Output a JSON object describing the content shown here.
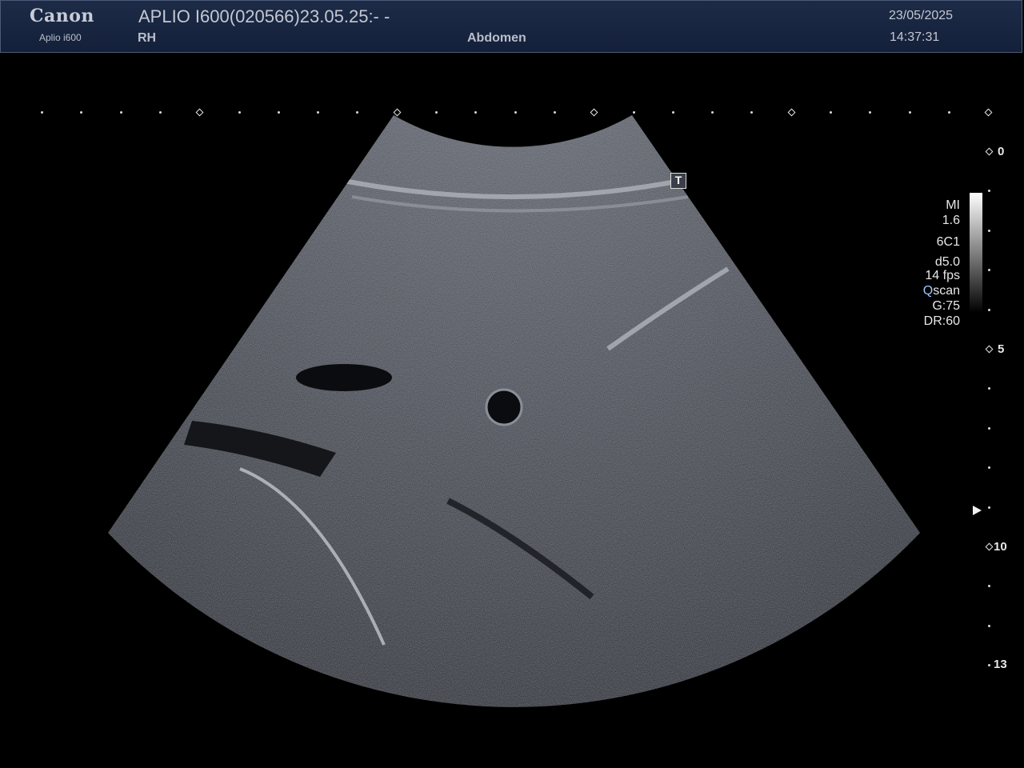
{
  "header": {
    "brand": "Canon",
    "model": "Aplio i600",
    "study": "APLIO I600(020566)23.05.25:- -",
    "side": "RH",
    "preset": "Abdomen",
    "date": "23/05/2025",
    "time": "14:37:31"
  },
  "focus_marker": "T",
  "params": {
    "mi_label": "MI",
    "mi_value": "1.6",
    "probe": "6C1",
    "depth": "d5.0",
    "fps": "14 fps",
    "mode_q": "Q",
    "mode_rest": "scan",
    "gain": "G:75",
    "dynamic_range": "DR:60"
  },
  "depth_scale": {
    "labels": [
      "0",
      "5",
      "10",
      "13"
    ]
  },
  "colors": {
    "header_bg": "#1d2b47",
    "accent_blue": "#9fc6ff",
    "scale": "#e8e8e8"
  }
}
